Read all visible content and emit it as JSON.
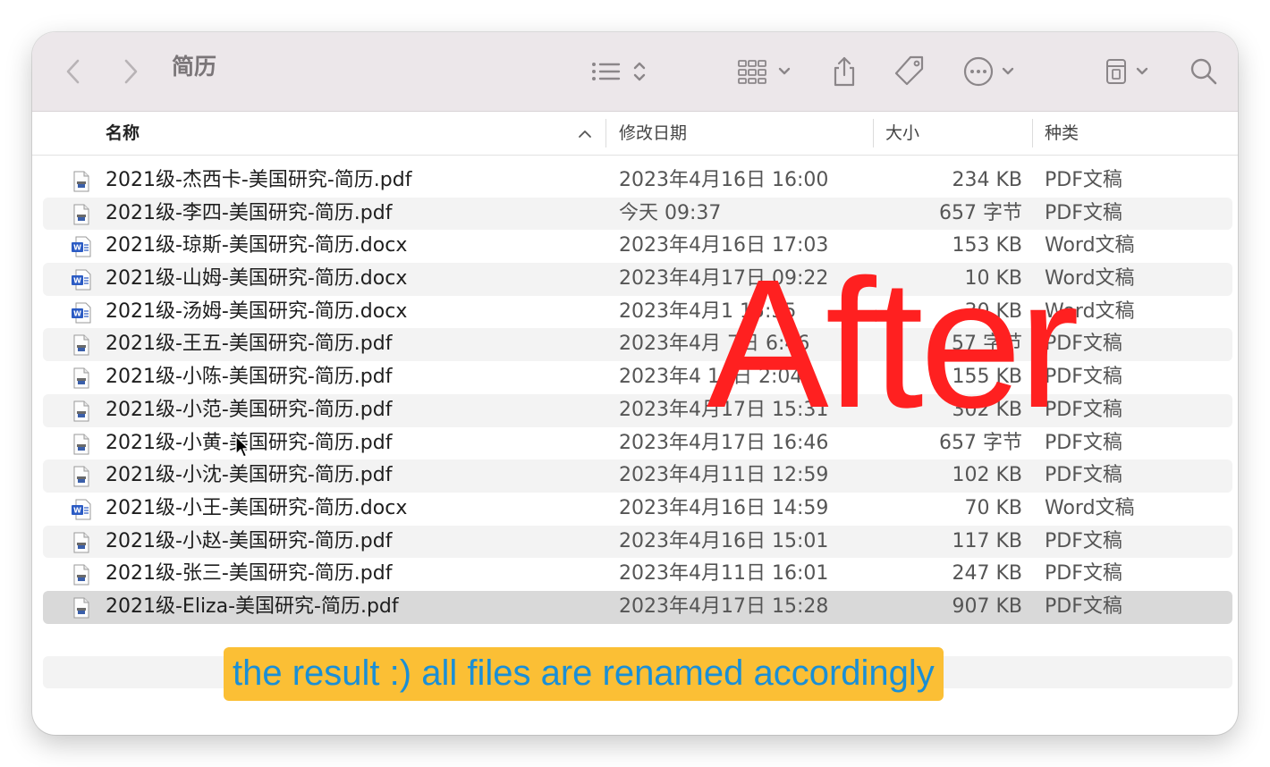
{
  "toolbar": {
    "title": "简历",
    "icons": [
      "chevron-left-icon",
      "chevron-right-icon",
      "list-view-icon",
      "grid-view-icon",
      "share-icon",
      "tag-icon",
      "more-icon",
      "drive-icon",
      "search-icon"
    ]
  },
  "columns": {
    "name": "名称",
    "date": "修改日期",
    "size": "大小",
    "kind": "种类"
  },
  "files": [
    {
      "name": "2021级-杰西卡-美国研究-简历.pdf",
      "date": "2023年4月16日 16:00",
      "size": "234 KB",
      "kind": "PDF文稿",
      "type": "pdf"
    },
    {
      "name": "2021级-李四-美国研究-简历.pdf",
      "date": "今天 09:37",
      "size": "657 字节",
      "kind": "PDF文稿",
      "type": "pdf"
    },
    {
      "name": "2021级-琼斯-美国研究-简历.docx",
      "date": "2023年4月16日 17:03",
      "size": "153 KB",
      "kind": "Word文稿",
      "type": "word"
    },
    {
      "name": "2021级-山姆-美国研究-简历.docx",
      "date": "2023年4月17日 09:22",
      "size": "10 KB",
      "kind": "Word文稿",
      "type": "word"
    },
    {
      "name": "2021级-汤姆-美国研究-简历.docx",
      "date": "2023年4月1 15:35",
      "size": "30 KB",
      "kind": "Word文稿",
      "type": "word"
    },
    {
      "name": "2021级-王五-美国研究-简历.pdf",
      "date": "2023年4月 7日 6:46",
      "size": "57 字节",
      "kind": "PDF文稿",
      "type": "pdf"
    },
    {
      "name": "2021级-小陈-美国研究-简历.pdf",
      "date": "2023年4 16日 2:04",
      "size": "155 KB",
      "kind": "PDF文稿",
      "type": "pdf"
    },
    {
      "name": "2021级-小范-美国研究-简历.pdf",
      "date": "2023年4月17日 15:31",
      "size": "302 KB",
      "kind": "PDF文稿",
      "type": "pdf"
    },
    {
      "name": "2021级-小黄-美国研究-简历.pdf",
      "date": "2023年4月17日 16:46",
      "size": "657 字节",
      "kind": "PDF文稿",
      "type": "pdf"
    },
    {
      "name": "2021级-小沈-美国研究-简历.pdf",
      "date": "2023年4月11日 12:59",
      "size": "102 KB",
      "kind": "PDF文稿",
      "type": "pdf"
    },
    {
      "name": "2021级-小王-美国研究-简历.docx",
      "date": "2023年4月16日 14:59",
      "size": "70 KB",
      "kind": "Word文稿",
      "type": "word"
    },
    {
      "name": "2021级-小赵-美国研究-简历.pdf",
      "date": "2023年4月16日 15:01",
      "size": "117 KB",
      "kind": "PDF文稿",
      "type": "pdf"
    },
    {
      "name": "2021级-张三-美国研究-简历.pdf",
      "date": "2023年4月11日 16:01",
      "size": "247 KB",
      "kind": "PDF文稿",
      "type": "pdf"
    },
    {
      "name": "2021级-Eliza-美国研究-简历.pdf",
      "date": "2023年4月17日 15:28",
      "size": "907 KB",
      "kind": "PDF文稿",
      "type": "pdf",
      "selected": true
    }
  ],
  "overlay": {
    "after_label": "After",
    "caption": "the result :) all files are renamed accordingly"
  },
  "colors": {
    "toolbar_bg": "#ece7ea",
    "after_red": "#ff2020",
    "caption_bg": "#fbbf35",
    "caption_text": "#1a8fd6",
    "word_blue": "#2b5bc4"
  }
}
